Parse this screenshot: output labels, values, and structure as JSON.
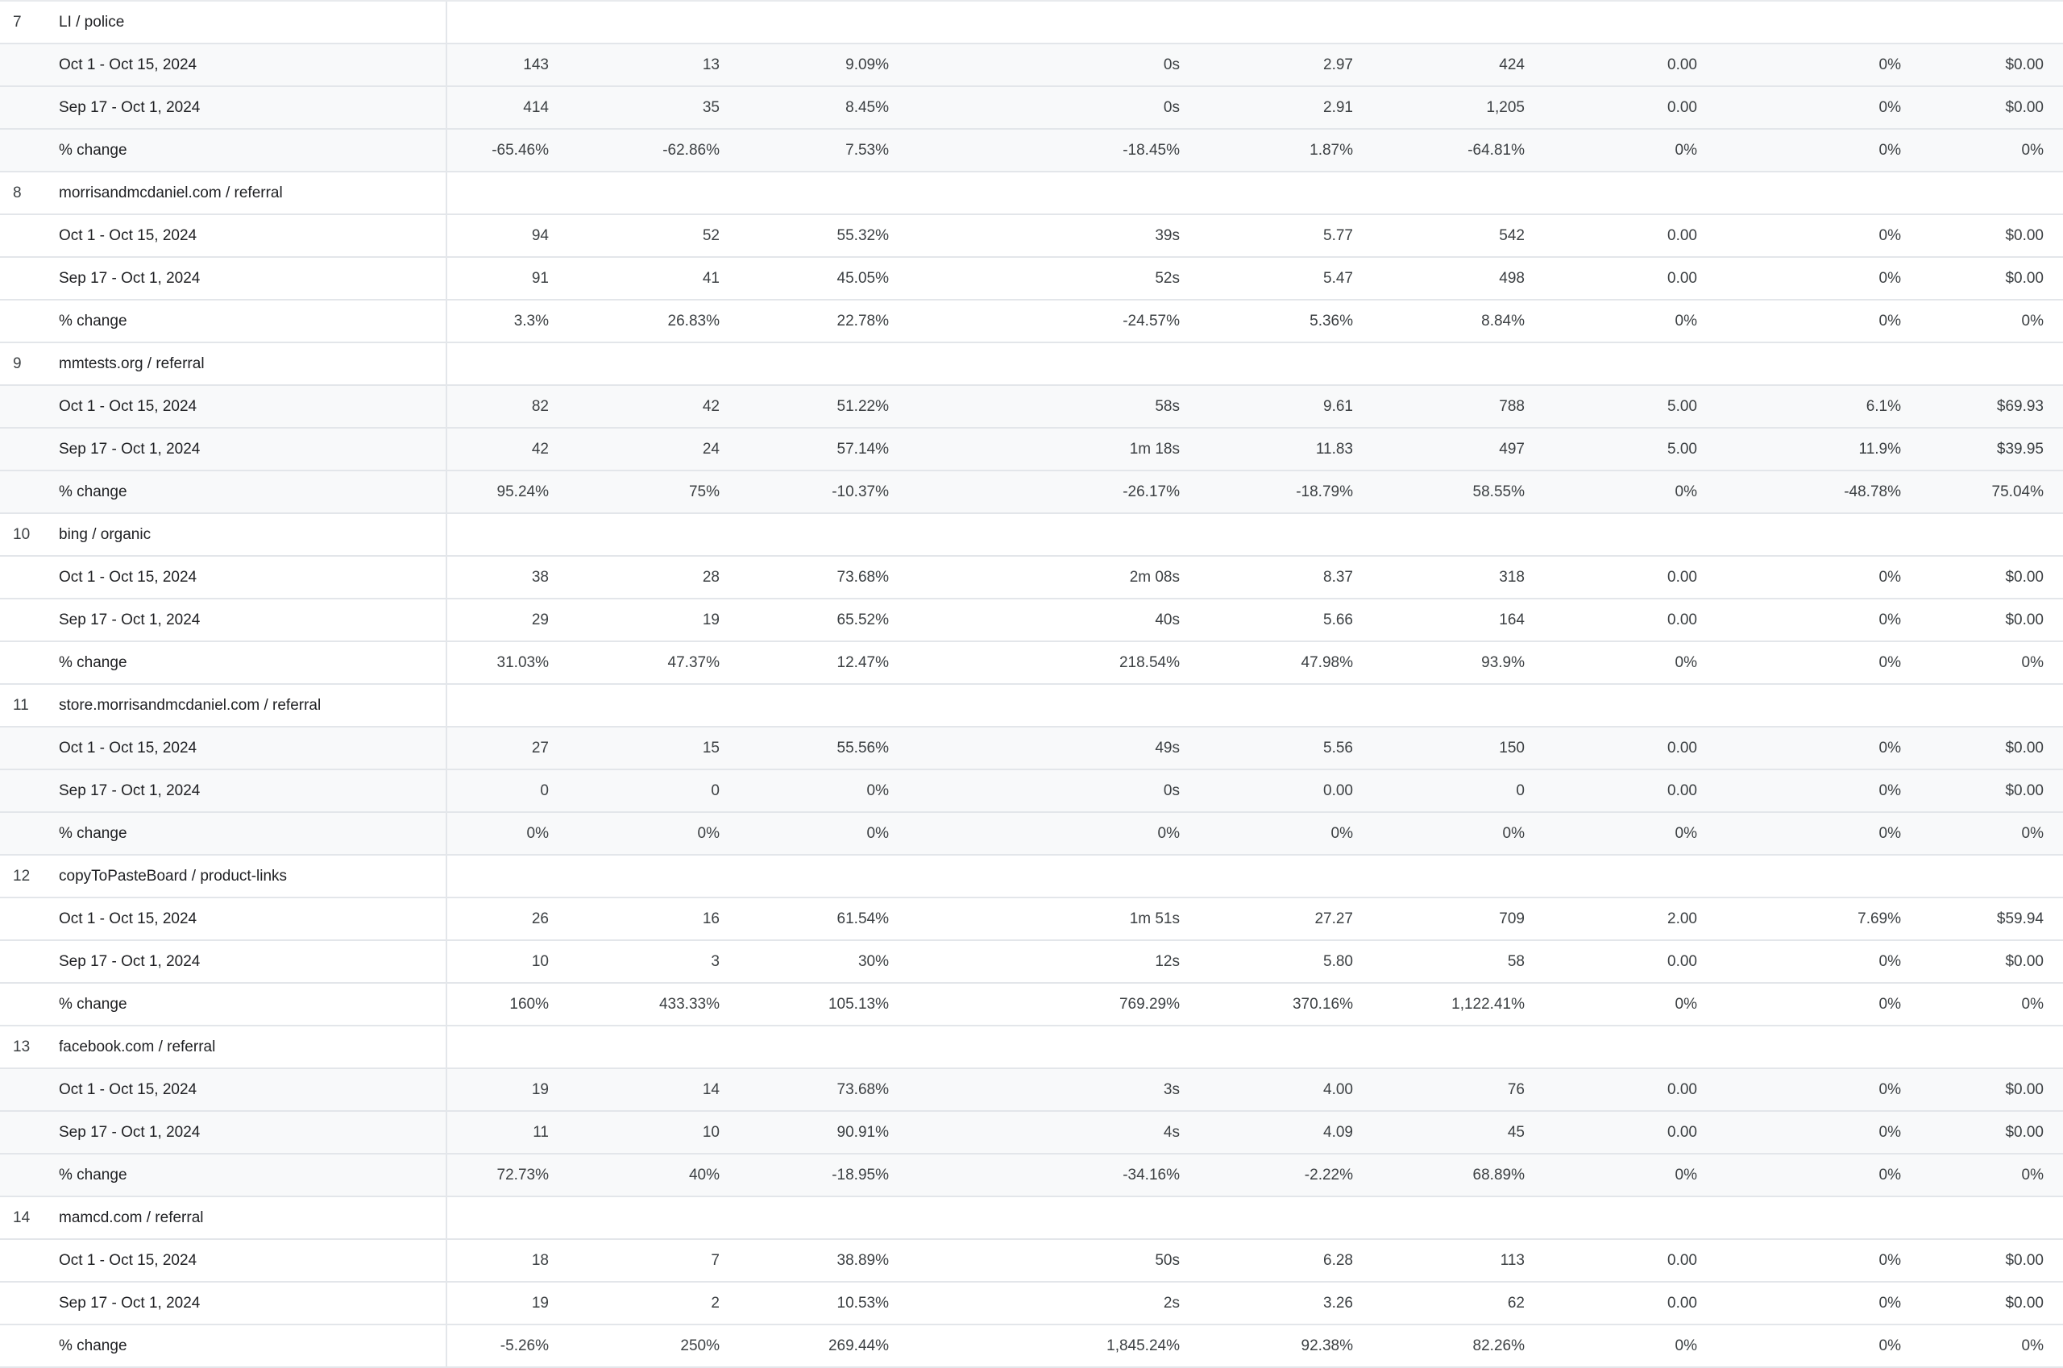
{
  "colors": {
    "row_shaded": "#f8f9fa",
    "border": "#e3e6ea",
    "text": "#202124",
    "muted_text": "#3c4043"
  },
  "groups": [
    {
      "index": "7",
      "name": "LI / police",
      "rows": [
        {
          "label": "Oct 1 - Oct 15, 2024",
          "values": [
            "143",
            "13",
            "9.09%",
            "0s",
            "2.97",
            "424",
            "0.00",
            "0%",
            "$0.00"
          ]
        },
        {
          "label": "Sep 17 - Oct 1, 2024",
          "values": [
            "414",
            "35",
            "8.45%",
            "0s",
            "2.91",
            "1,205",
            "0.00",
            "0%",
            "$0.00"
          ]
        },
        {
          "label": "% change",
          "values": [
            "-65.46%",
            "-62.86%",
            "7.53%",
            "-18.45%",
            "1.87%",
            "-64.81%",
            "0%",
            "0%",
            "0%"
          ]
        }
      ]
    },
    {
      "index": "8",
      "name": "morrisandmcdaniel.com / referral",
      "rows": [
        {
          "label": "Oct 1 - Oct 15, 2024",
          "values": [
            "94",
            "52",
            "55.32%",
            "39s",
            "5.77",
            "542",
            "0.00",
            "0%",
            "$0.00"
          ]
        },
        {
          "label": "Sep 17 - Oct 1, 2024",
          "values": [
            "91",
            "41",
            "45.05%",
            "52s",
            "5.47",
            "498",
            "0.00",
            "0%",
            "$0.00"
          ]
        },
        {
          "label": "% change",
          "values": [
            "3.3%",
            "26.83%",
            "22.78%",
            "-24.57%",
            "5.36%",
            "8.84%",
            "0%",
            "0%",
            "0%"
          ]
        }
      ]
    },
    {
      "index": "9",
      "name": "mmtests.org / referral",
      "rows": [
        {
          "label": "Oct 1 - Oct 15, 2024",
          "values": [
            "82",
            "42",
            "51.22%",
            "58s",
            "9.61",
            "788",
            "5.00",
            "6.1%",
            "$69.93"
          ]
        },
        {
          "label": "Sep 17 - Oct 1, 2024",
          "values": [
            "42",
            "24",
            "57.14%",
            "1m 18s",
            "11.83",
            "497",
            "5.00",
            "11.9%",
            "$39.95"
          ]
        },
        {
          "label": "% change",
          "values": [
            "95.24%",
            "75%",
            "-10.37%",
            "-26.17%",
            "-18.79%",
            "58.55%",
            "0%",
            "-48.78%",
            "75.04%"
          ]
        }
      ]
    },
    {
      "index": "10",
      "name": "bing / organic",
      "rows": [
        {
          "label": "Oct 1 - Oct 15, 2024",
          "values": [
            "38",
            "28",
            "73.68%",
            "2m 08s",
            "8.37",
            "318",
            "0.00",
            "0%",
            "$0.00"
          ]
        },
        {
          "label": "Sep 17 - Oct 1, 2024",
          "values": [
            "29",
            "19",
            "65.52%",
            "40s",
            "5.66",
            "164",
            "0.00",
            "0%",
            "$0.00"
          ]
        },
        {
          "label": "% change",
          "values": [
            "31.03%",
            "47.37%",
            "12.47%",
            "218.54%",
            "47.98%",
            "93.9%",
            "0%",
            "0%",
            "0%"
          ]
        }
      ]
    },
    {
      "index": "11",
      "name": "store.morrisandmcdaniel.com / referral",
      "rows": [
        {
          "label": "Oct 1 - Oct 15, 2024",
          "values": [
            "27",
            "15",
            "55.56%",
            "49s",
            "5.56",
            "150",
            "0.00",
            "0%",
            "$0.00"
          ]
        },
        {
          "label": "Sep 17 - Oct 1, 2024",
          "values": [
            "0",
            "0",
            "0%",
            "0s",
            "0.00",
            "0",
            "0.00",
            "0%",
            "$0.00"
          ]
        },
        {
          "label": "% change",
          "values": [
            "0%",
            "0%",
            "0%",
            "0%",
            "0%",
            "0%",
            "0%",
            "0%",
            "0%"
          ]
        }
      ]
    },
    {
      "index": "12",
      "name": "copyToPasteBoard / product-links",
      "rows": [
        {
          "label": "Oct 1 - Oct 15, 2024",
          "values": [
            "26",
            "16",
            "61.54%",
            "1m 51s",
            "27.27",
            "709",
            "2.00",
            "7.69%",
            "$59.94"
          ]
        },
        {
          "label": "Sep 17 - Oct 1, 2024",
          "values": [
            "10",
            "3",
            "30%",
            "12s",
            "5.80",
            "58",
            "0.00",
            "0%",
            "$0.00"
          ]
        },
        {
          "label": "% change",
          "values": [
            "160%",
            "433.33%",
            "105.13%",
            "769.29%",
            "370.16%",
            "1,122.41%",
            "0%",
            "0%",
            "0%"
          ]
        }
      ]
    },
    {
      "index": "13",
      "name": "facebook.com / referral",
      "rows": [
        {
          "label": "Oct 1 - Oct 15, 2024",
          "values": [
            "19",
            "14",
            "73.68%",
            "3s",
            "4.00",
            "76",
            "0.00",
            "0%",
            "$0.00"
          ]
        },
        {
          "label": "Sep 17 - Oct 1, 2024",
          "values": [
            "11",
            "10",
            "90.91%",
            "4s",
            "4.09",
            "45",
            "0.00",
            "0%",
            "$0.00"
          ]
        },
        {
          "label": "% change",
          "values": [
            "72.73%",
            "40%",
            "-18.95%",
            "-34.16%",
            "-2.22%",
            "68.89%",
            "0%",
            "0%",
            "0%"
          ]
        }
      ]
    },
    {
      "index": "14",
      "name": "mamcd.com / referral",
      "rows": [
        {
          "label": "Oct 1 - Oct 15, 2024",
          "values": [
            "18",
            "7",
            "38.89%",
            "50s",
            "6.28",
            "113",
            "0.00",
            "0%",
            "$0.00"
          ]
        },
        {
          "label": "Sep 17 - Oct 1, 2024",
          "values": [
            "19",
            "2",
            "10.53%",
            "2s",
            "3.26",
            "62",
            "0.00",
            "0%",
            "$0.00"
          ]
        },
        {
          "label": "% change",
          "values": [
            "-5.26%",
            "250%",
            "269.44%",
            "1,845.24%",
            "92.38%",
            "82.26%",
            "0%",
            "0%",
            "0%"
          ]
        }
      ]
    }
  ]
}
